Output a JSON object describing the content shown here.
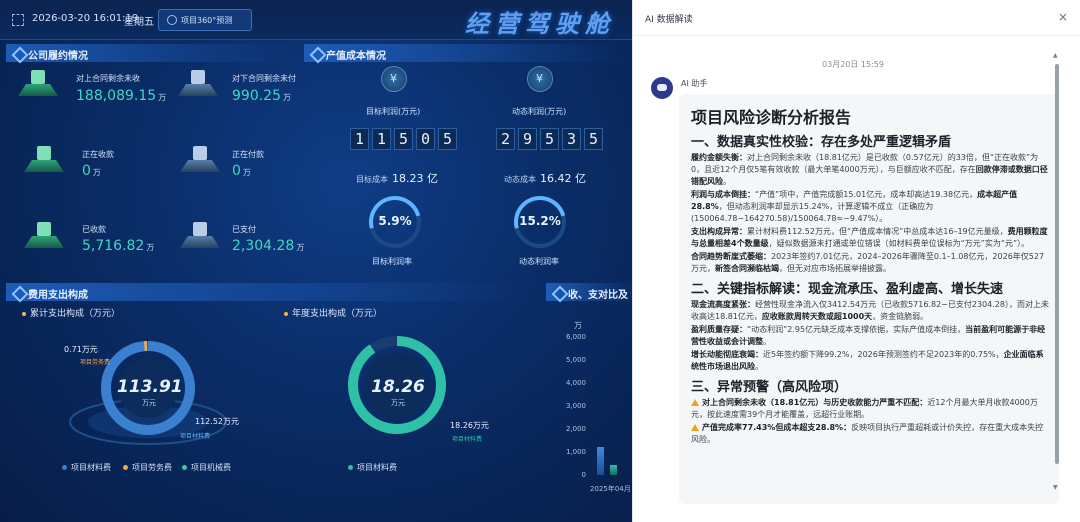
{
  "header": {
    "datetime": "2026-03-20 16:01:19",
    "weekday": "星期五",
    "project_button": "项目360°预测",
    "title": "经营驾驶舱"
  },
  "contract": {
    "section_title": "公司履约情况",
    "metrics": [
      {
        "label": "对上合同剩余未收",
        "value": "188,089.15",
        "unit": "万"
      },
      {
        "label": "对下合同剩余未付",
        "value": "990.25",
        "unit": "万"
      },
      {
        "label": "正在收款",
        "value": "0",
        "unit": "万"
      },
      {
        "label": "正在付款",
        "value": "0",
        "unit": "万"
      },
      {
        "label": "已收款",
        "value": "5,716.82",
        "unit": "万"
      },
      {
        "label": "已支付",
        "value": "2,304.28",
        "unit": "万"
      }
    ]
  },
  "output": {
    "section_title": "产值成本情况",
    "target": {
      "label": "目标利润(万元)",
      "digits": [
        "1",
        "1",
        "5",
        "0",
        "5"
      ],
      "cost_label": "目标成本",
      "cost_value": "18.23 亿",
      "rate": "5.9%",
      "rate_label": "目标利润率"
    },
    "dynamic": {
      "label": "动态利润(万元)",
      "digits": [
        "2",
        "9",
        "5",
        "3",
        "5"
      ],
      "cost_label": "动态成本",
      "cost_value": "16.42 亿",
      "rate": "15.2%",
      "rate_label": "动态利润率"
    }
  },
  "expense": {
    "section_title": "费用支出构成",
    "cumulative": {
      "title": "累计支出构成（万元）",
      "center_value": "113.91",
      "center_unit": "万元",
      "callout_top_value": "0.71万元",
      "callout_top_label": "项目劳务费",
      "callout_bottom_value": "112.52万元",
      "callout_bottom_label": "项目材料费",
      "legend": [
        "项目材料费",
        "项目劳务费",
        "项目机械费"
      ]
    },
    "annual": {
      "title": "年度支出构成（万元）",
      "center_value": "18.26",
      "center_unit": "万元",
      "callout_value": "18.26万元",
      "callout_label": "项目材料费",
      "legend": [
        "项目材料费"
      ]
    },
    "ratio": {
      "section_title": "收、支对比及",
      "unit": "万",
      "ticks": [
        "6,000",
        "5,000",
        "4,000",
        "3,000",
        "2,000",
        "1,000",
        "0"
      ],
      "x_label": "2025年04月"
    }
  },
  "ai_panel": {
    "title": "AI 数据解读",
    "close": "×",
    "timestamp": "03月20日 15:59",
    "assistant_name": "AI 助手",
    "report_title": "项目风险诊断分析报告",
    "s1_title": "一、数据真实性校验：存在多处严重逻辑矛盾",
    "p1_lead": "履约金额失衡：",
    "p1_a": "对上合同剩余未收（18.81亿元）是已收款（0.57亿元）的33倍，但“正在收款”为0，且近12个月仅5笔有效收款（最大单笔4000万元），与巨额应收不匹配，存在",
    "p1_bold": "回款停滞或数据口径错配风险",
    "p1_end": "。",
    "p2_lead": "利润与成本倒挂：",
    "p2_a": "“产值”项中，产值完成额15.01亿元，成本却高达19.38亿元，",
    "p2_bold": "成本超产值28.8%",
    "p2_b": "，但动态利润率却显示15.24%，计算逻辑不成立（正确应为(150064.78−164270.58)/150064.78≈−9.47%）。",
    "p3_lead": "支出构成异常：",
    "p3_a": "累计材料费112.52万元，但“产值成本情况”中总成本达16–19亿元量级，",
    "p3_bold": "费用颗粒度与总量相差4个数量级",
    "p3_b": "，疑似数据源未打通或单位错误（如材料费单位误标为“万元”实为“元”）。",
    "p4_lead": "合同趋势断崖式萎缩：",
    "p4_a": "2023年签约7.01亿元，2024–2026年骤降至0.1–1.08亿元，2026年仅527万元，",
    "p4_bold": "新签合同濒临枯竭",
    "p4_b": "，但无对应市场拓展举措披露。",
    "s2_title": "二、关键指标解读：现金流承压、盈利虚高、增长失速",
    "p5_lead": "现金流高度紧张：",
    "p5_a": "经营性现金净流入仅3412.54万元（已收款5716.82−已支付2304.28），而对上未收高达18.81亿元，",
    "p5_bold": "应收账款周转天数或超1000天",
    "p5_b": "，资金链脆弱。",
    "p6_lead": "盈利质量存疑：",
    "p6_a": "“动态利润”2.95亿元缺乏成本支撑依据，实际产值成本倒挂，",
    "p6_bold": "当前盈利可能源于非经营性收益或会计调整",
    "p6_b": "。",
    "p7_lead": "增长动能彻底衰竭：",
    "p7_a": "近5年签约额下降99.2%，2026年预测签约不足2023年的0.75%，",
    "p7_bold": "企业面临系统性市场退出风险",
    "p7_b": "。",
    "s3_title": "三、异常预警（高风险项）",
    "w1_bold": "对上合同剩余未收（18.81亿元）与历史收款能力严重不匹配：",
    "w1_a": "近12个月最大单月收款4000万元，按此速度需39个月才能覆盖，远超行业账期。",
    "w2_bold": "产值完成率77.43%但成本超支28.8%：",
    "w2_a": "反映项目执行严重超耗或计价失控，存在重大成本失控风险。",
    "scroll_up": "▲",
    "scroll_down": "▼"
  },
  "colors": {
    "dash_bg": "#0a2c66",
    "accent_teal": "#3fd9c4",
    "ring_blue": "#5fb5ff",
    "warning": "#f0a21a"
  }
}
